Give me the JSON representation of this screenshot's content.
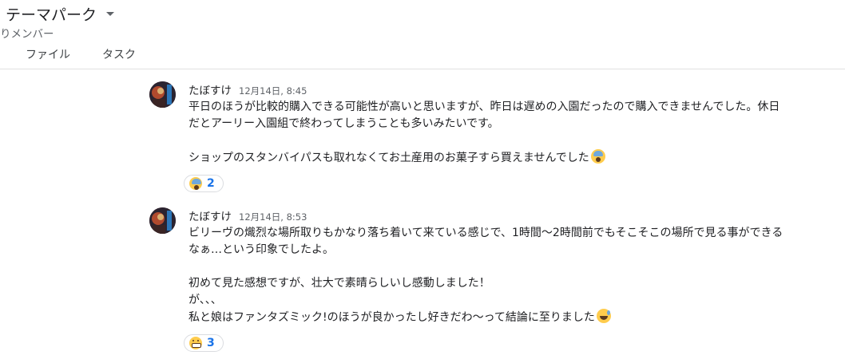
{
  "header": {
    "room_title": "テーマパーク",
    "subtitle": "りメンバー",
    "tabs": [
      {
        "label": "ファイル"
      },
      {
        "label": "タスク"
      }
    ]
  },
  "messages": [
    {
      "author": "たぼすけ",
      "timestamp": "12月14日, 8:45",
      "lines": [
        "平日のほうが比較的購入できる可能性が高いと思いますが、昨日は遅めの入園だったので購入できませんでした。休日",
        "だとアーリー入園組で終わってしまうことも多いみたいです。",
        "",
        "ショップのスタンバイパスも取れなくてお土産用のお菓子すら買えませんでした"
      ],
      "trailing_emoji": "face-screaming-in-fear-icon",
      "reaction": {
        "emoji": "face-screaming-in-fear-icon",
        "count": "2"
      }
    },
    {
      "author": "たぼすけ",
      "timestamp": "12月14日, 8:53",
      "lines": [
        "ビリーヴの熾烈な場所取りもかなり落ち着いて来ている感じで、1時間〜2時間前でもそこそこの場所で見る事ができる",
        "なぁ…という印象でしたよ。",
        "",
        "初めて見た感想ですが、壮大で素晴らしいし感動しました！",
        "が、、、",
        "私と娘はファンタズミック!のほうが良かったし好きだわ〜って結論に至りました"
      ],
      "trailing_emoji": "grinning-face-with-sweat-icon",
      "reaction": {
        "emoji": "grimacing-face-icon",
        "count": "3"
      }
    }
  ]
}
